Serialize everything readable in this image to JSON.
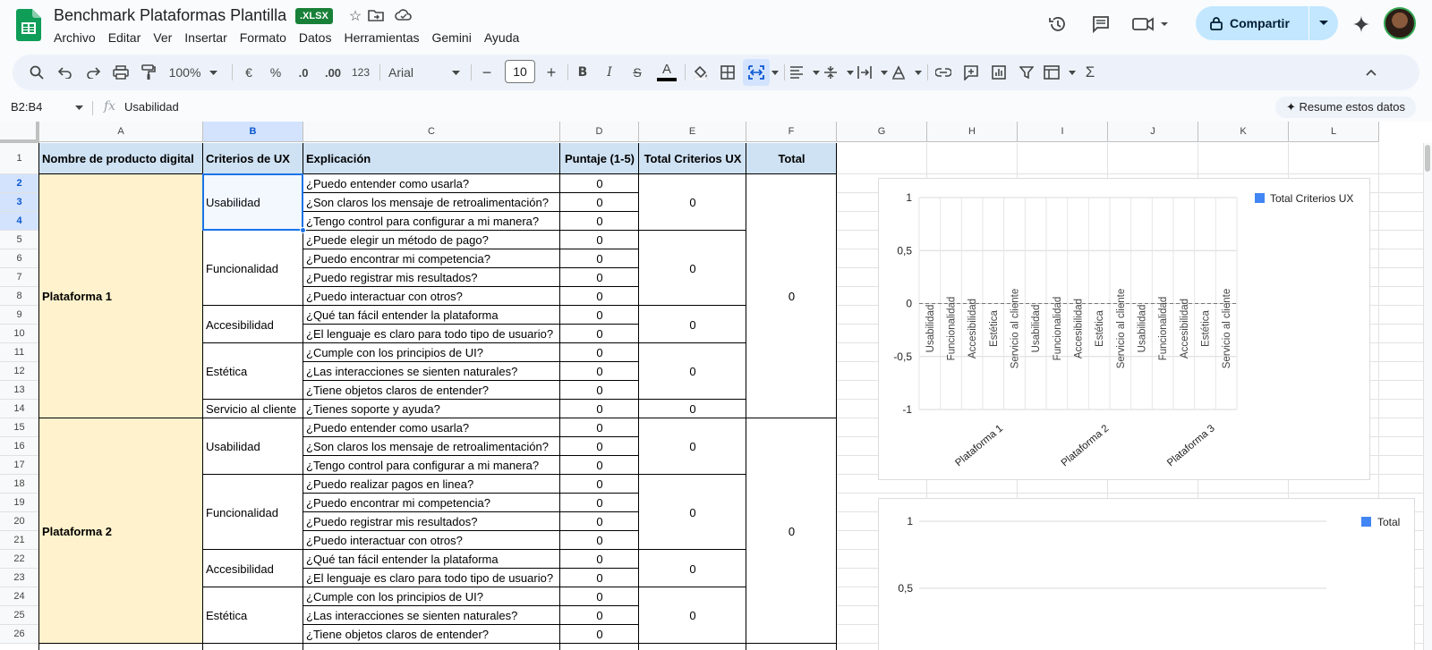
{
  "app": {
    "doc_title": "Benchmark Plataformas Plantilla",
    "file_badge": ".XLSX",
    "menu": [
      "Archivo",
      "Editar",
      "Ver",
      "Insertar",
      "Formato",
      "Datos",
      "Herramientas",
      "Gemini",
      "Ayuda"
    ],
    "share_label": "Compartir"
  },
  "toolbar": {
    "zoom": "100%",
    "currency": "€",
    "percent": "%",
    "dec_decrease": ".0",
    "dec_increase": ".00",
    "number_format": "123",
    "font": "Arial",
    "font_size": "10"
  },
  "formula_bar": {
    "name_box": "B2:B4",
    "fx": "fx",
    "formula": "Usabilidad",
    "summarize_label": "Resume estos datos"
  },
  "columns": [
    "A",
    "B",
    "C",
    "D",
    "E",
    "F",
    "G",
    "H",
    "I",
    "J",
    "K",
    "L"
  ],
  "rows": [
    "1",
    "2",
    "3",
    "4",
    "5",
    "6",
    "7",
    "8",
    "9",
    "10",
    "11",
    "12",
    "13",
    "14",
    "15",
    "16",
    "17",
    "18",
    "19",
    "20",
    "21",
    "22",
    "23",
    "24",
    "25",
    "26"
  ],
  "sheet": {
    "headers": {
      "a": "Nombre de producto digital",
      "b": "Criterios de UX",
      "c": "Explicación",
      "d": "Puntaje (1-5)",
      "e": "Total Criterios UX",
      "f": "Total"
    },
    "platforms": [
      {
        "name": "Plataforma 1",
        "total": "0",
        "groups": [
          {
            "criterion": "Usabilidad",
            "total": "0",
            "items": [
              {
                "q": "¿Puedo entender como usarla?",
                "score": "0"
              },
              {
                "q": "¿Son claros los mensaje de retroalimentación?",
                "score": "0"
              },
              {
                "q": "¿Tengo control para configurar a mi manera?",
                "score": "0"
              }
            ]
          },
          {
            "criterion": "Funcionalidad",
            "total": "0",
            "items": [
              {
                "q": "¿Puede elegir un método de pago?",
                "score": "0"
              },
              {
                "q": "¿Puedo encontrar mi competencia?",
                "score": "0"
              },
              {
                "q": "¿Puedo registrar mis resultados?",
                "score": "0"
              },
              {
                "q": "¿Puedo interactuar con otros?",
                "score": "0"
              }
            ]
          },
          {
            "criterion": "Accesibilidad",
            "total": "0",
            "items": [
              {
                "q": "¿Qué tan fácil entender la plataforma",
                "score": "0"
              },
              {
                "q": "¿El lenguaje es claro para todo tipo de usuario?",
                "score": "0"
              }
            ]
          },
          {
            "criterion": "Estética",
            "total": "0",
            "items": [
              {
                "q": "¿Cumple con los principios de UI?",
                "score": "0"
              },
              {
                "q": "¿Las interacciones se sienten naturales?",
                "score": "0"
              },
              {
                "q": "¿Tiene objetos claros de entender?",
                "score": "0"
              }
            ]
          },
          {
            "criterion": "Servicio al cliente",
            "total": "0",
            "items": [
              {
                "q": "¿Tienes soporte y ayuda?",
                "score": "0"
              }
            ]
          }
        ]
      },
      {
        "name": "Plataforma 2",
        "total": "0",
        "groups": [
          {
            "criterion": "Usabilidad",
            "total": "0",
            "items": [
              {
                "q": "¿Puedo entender como usarla?",
                "score": "0"
              },
              {
                "q": "¿Son claros los mensaje de retroalimentación?",
                "score": "0"
              },
              {
                "q": "¿Tengo control para configurar a mi manera?",
                "score": "0"
              }
            ]
          },
          {
            "criterion": "Funcionalidad",
            "total": "0",
            "items": [
              {
                "q": "¿Puedo realizar pagos en linea?",
                "score": "0"
              },
              {
                "q": "¿Puedo encontrar mi competencia?",
                "score": "0"
              },
              {
                "q": "¿Puedo registrar mis resultados?",
                "score": "0"
              },
              {
                "q": "¿Puedo interactuar con otros?",
                "score": "0"
              }
            ]
          },
          {
            "criterion": "Accesibilidad",
            "total": "0",
            "items": [
              {
                "q": "¿Qué tan fácil entender la plataforma",
                "score": "0"
              },
              {
                "q": "¿El lenguaje es claro para todo tipo de usuario?",
                "score": "0"
              }
            ]
          },
          {
            "criterion": "Estética",
            "total": "0",
            "items": [
              {
                "q": "¿Cumple con los principios de UI?",
                "score": "0"
              },
              {
                "q": "¿Las interacciones se sienten naturales?",
                "score": "0"
              },
              {
                "q": "¿Tiene objetos claros de entender?",
                "score": "0"
              }
            ]
          }
        ]
      }
    ]
  },
  "colors": {
    "header_fill": "#cfe2f3",
    "platform_fill": "#fff2cc",
    "selection": "#1a73e8",
    "series": "#4285f4",
    "share_bg": "#c2e7ff"
  },
  "chart_data": [
    {
      "type": "bar",
      "legend": "Total Criterios UX",
      "legend_position": "top-right",
      "ylim": [
        -1,
        1
      ],
      "y_ticks": [
        "1",
        "0,5",
        "0",
        "-0,5",
        "-1"
      ],
      "grid": true,
      "platforms": [
        "Plataforma 1",
        "Plataforma 2",
        "Plataforma 3"
      ],
      "categories": [
        "Usabilidad",
        "Funcionalidad",
        "Accesibilidad",
        "Estética",
        "Servicio al cliente",
        "Usabilidad",
        "Funcionalidad",
        "Accesibilidad",
        "Estética",
        "Servicio al cliente",
        "Usabilidad",
        "Funcionalidad",
        "Accesibilidad",
        "Estética",
        "Servicio al cliente"
      ],
      "series": [
        {
          "name": "Total Criterios UX",
          "values": [
            0,
            0,
            0,
            0,
            0,
            0,
            0,
            0,
            0,
            0,
            0,
            0,
            0,
            0,
            0
          ]
        }
      ]
    },
    {
      "type": "bar",
      "legend": "Total",
      "legend_position": "top-right",
      "y_ticks": [
        "1",
        "0,5"
      ],
      "grid": true,
      "series": [
        {
          "name": "Total",
          "values": []
        }
      ]
    }
  ]
}
